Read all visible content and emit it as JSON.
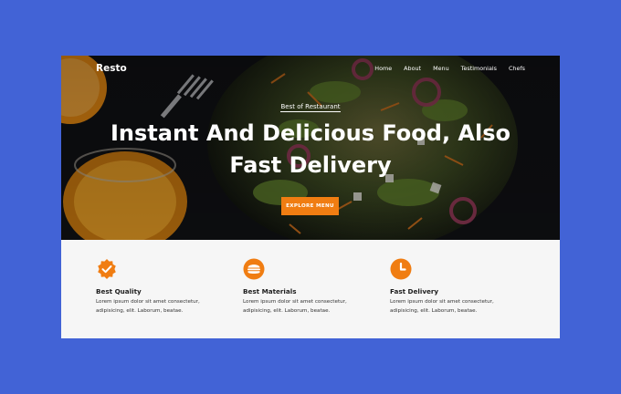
{
  "brand": "Resto",
  "nav": [
    "Home",
    "About",
    "Menu",
    "Testimonials",
    "Chefs"
  ],
  "hero": {
    "eyebrow": "Best of Restaurant",
    "headline": "Instant And Delicious Food, Also Fast Delivery",
    "cta": "EXPLORE MENU"
  },
  "features": [
    {
      "icon": "badge-check-icon",
      "title": "Best Quality",
      "desc": "Lorem ipsum dolor sit amet consectetur, adipisicing, elit. Laborum, beatae."
    },
    {
      "icon": "burger-icon",
      "title": "Best Materials",
      "desc": "Lorem ipsum dolor sit amet consectetur, adipisicing, elit. Laborum, beatae."
    },
    {
      "icon": "clock-icon",
      "title": "Fast Delivery",
      "desc": "Lorem ipsum dolor sit amet consectetur, adipisicing, elit. Laborum, beatae."
    }
  ],
  "colors": {
    "accent": "#f07d12",
    "page_background": "#4263d6",
    "hero_background": "#0e0f12",
    "section_background": "#f6f6f6"
  }
}
